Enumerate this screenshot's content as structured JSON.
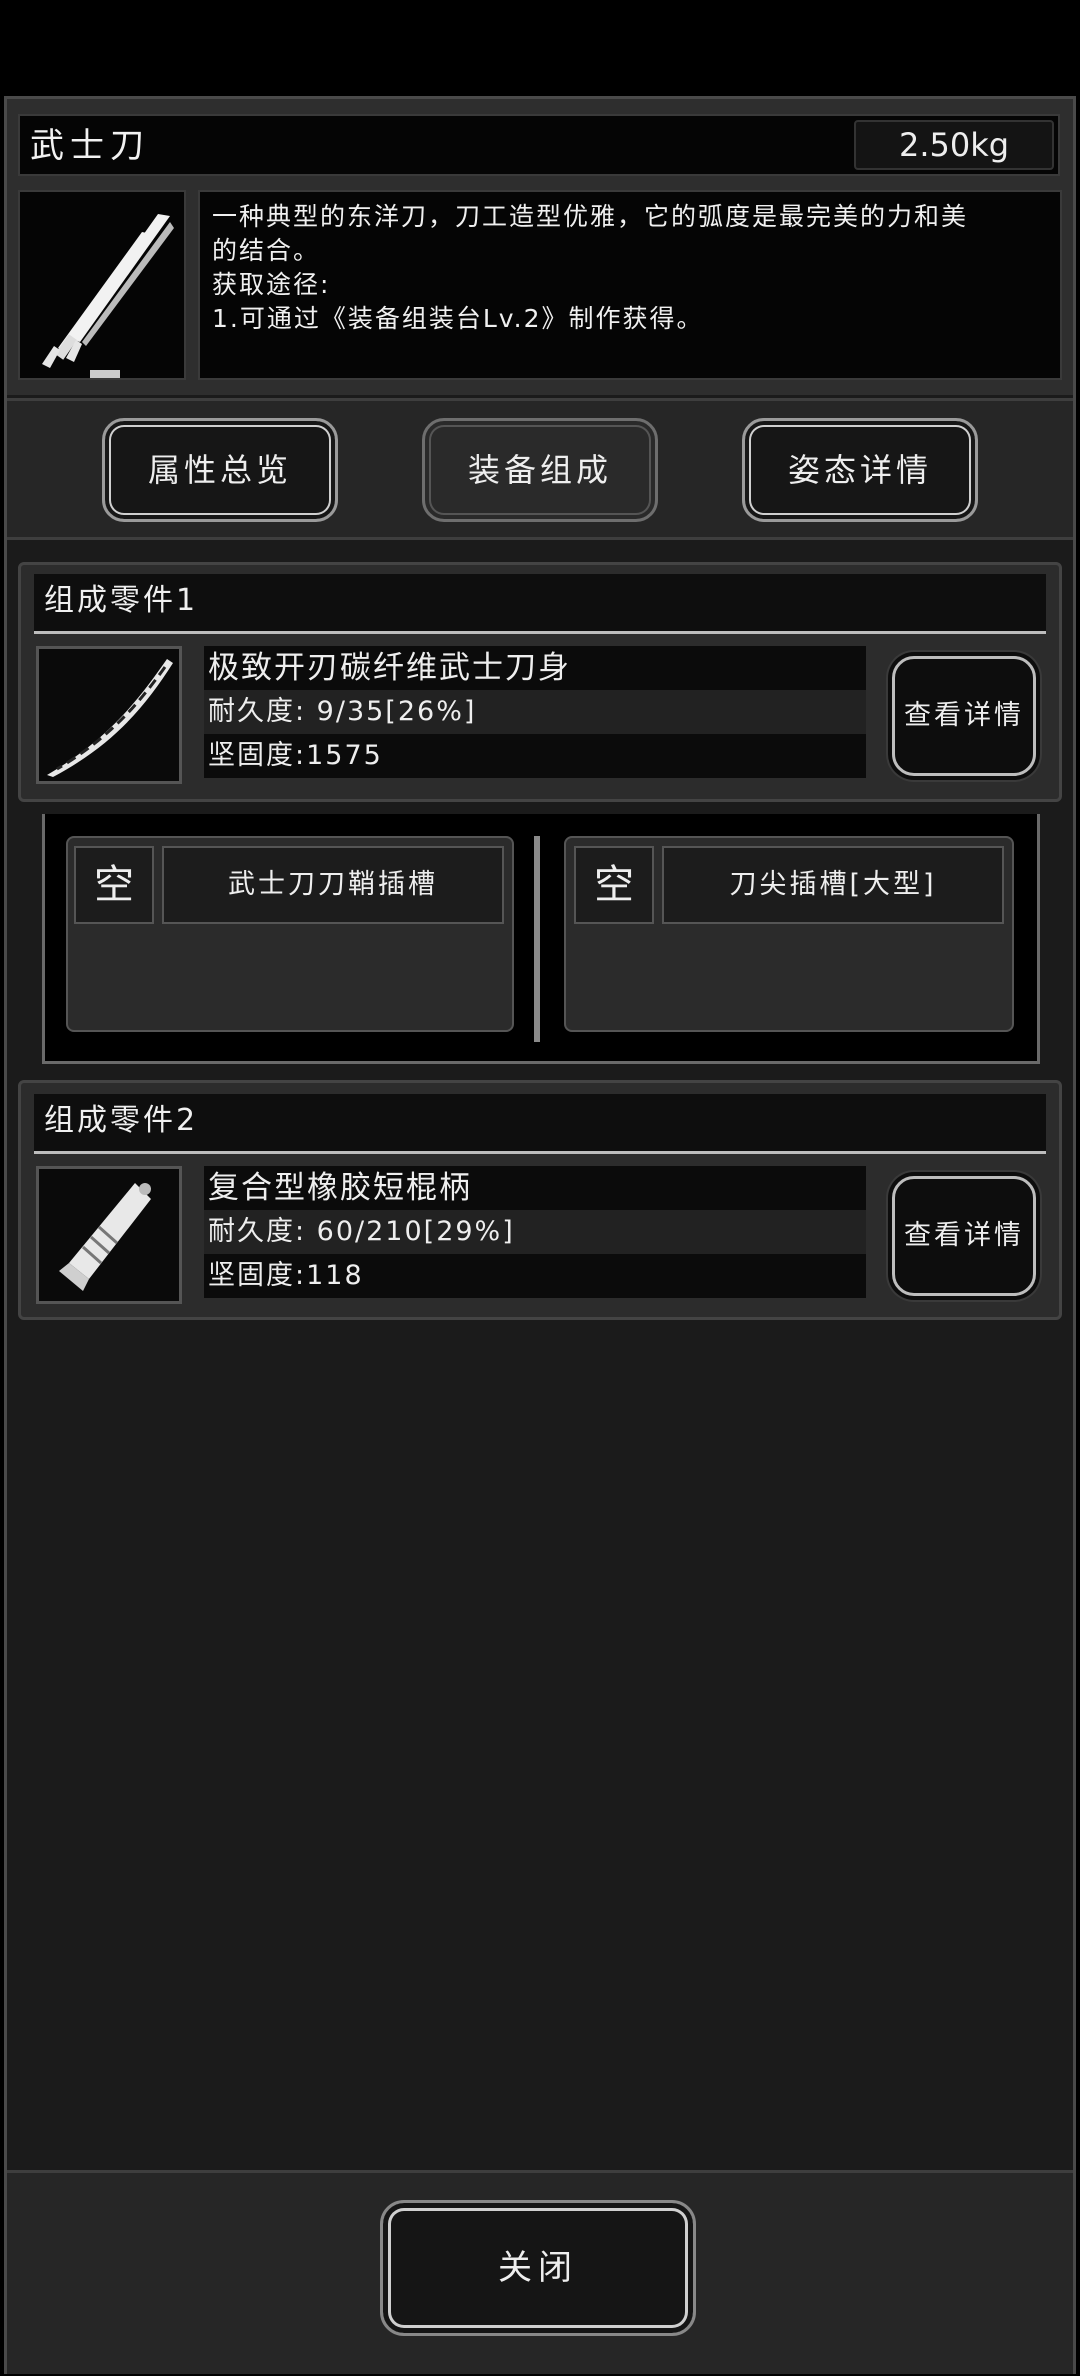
{
  "item": {
    "title": "武士刀",
    "weight": "2.50kg",
    "description_line1": "一种典型的东洋刀，刀工造型优雅，它的弧度是最完美的力和美",
    "description_line2": "的结合。",
    "acquire_label": "获取途径:",
    "acquire_1": "1.可通过《装备组装台Lv.2》制作获得。"
  },
  "tabs": [
    {
      "label": "属性总览"
    },
    {
      "label": "装备组成"
    },
    {
      "label": "姿态详情"
    }
  ],
  "parts": [
    {
      "section_title": "组成零件1",
      "name": "极致开刃碳纤维武士刀身",
      "durability": "耐久度: 9/35[26%]",
      "hardness": "坚固度:1575",
      "detail_label": "查看详情"
    },
    {
      "section_title": "组成零件2",
      "name": "复合型橡胶短棍柄",
      "durability": "耐久度: 60/210[29%]",
      "hardness": "坚固度:118",
      "detail_label": "查看详情"
    }
  ],
  "slots": [
    {
      "state": "空",
      "label": "武士刀刀鞘插槽"
    },
    {
      "state": "空",
      "label": "刀尖插槽[大型]"
    }
  ],
  "footer": {
    "close_label": "关闭"
  },
  "colors": {
    "background": "#1b1b1b",
    "panel": "#2c2c2c",
    "frame": "#4a4a4a",
    "text": "#e8e8e8"
  }
}
